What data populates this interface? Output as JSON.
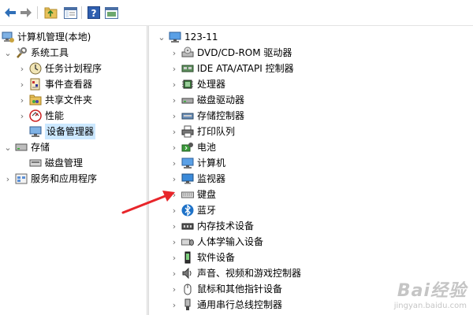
{
  "toolbar": {
    "icons": [
      "back-arrow-icon",
      "forward-arrow-icon",
      "up-folder-icon",
      "show-hide-tree-icon",
      "help-icon",
      "properties-icon"
    ]
  },
  "left_tree": {
    "root": "计算机管理(本地)",
    "system_tools": "系统工具",
    "task_scheduler": "任务计划程序",
    "event_viewer": "事件查看器",
    "shared_folders": "共享文件夹",
    "performance": "性能",
    "device_manager": "设备管理器",
    "storage": "存储",
    "disk_management": "磁盘管理",
    "services_apps": "服务和应用程序"
  },
  "right_tree": {
    "computer_name": "123-11",
    "categories": [
      {
        "label": "DVD/CD-ROM 驱动器",
        "icon": "dvd-drive-icon"
      },
      {
        "label": "IDE ATA/ATAPI 控制器",
        "icon": "ide-controller-icon"
      },
      {
        "label": "处理器",
        "icon": "processor-icon"
      },
      {
        "label": "磁盘驱动器",
        "icon": "disk-drive-icon"
      },
      {
        "label": "存储控制器",
        "icon": "storage-controller-icon"
      },
      {
        "label": "打印队列",
        "icon": "printer-icon"
      },
      {
        "label": "电池",
        "icon": "battery-icon"
      },
      {
        "label": "计算机",
        "icon": "computer-icon"
      },
      {
        "label": "监视器",
        "icon": "monitor-icon"
      },
      {
        "label": "键盘",
        "icon": "keyboard-icon"
      },
      {
        "label": "蓝牙",
        "icon": "bluetooth-icon"
      },
      {
        "label": "内存技术设备",
        "icon": "memory-device-icon"
      },
      {
        "label": "人体学输入设备",
        "icon": "hid-icon"
      },
      {
        "label": "软件设备",
        "icon": "software-device-icon"
      },
      {
        "label": "声音、视频和游戏控制器",
        "icon": "sound-icon"
      },
      {
        "label": "鼠标和其他指针设备",
        "icon": "mouse-icon"
      },
      {
        "label": "通用串行总线控制器",
        "icon": "usb-icon"
      }
    ]
  },
  "annotation": {
    "color": "#e8252a"
  },
  "watermark": {
    "main": "Bai经验",
    "sub": "jingyan.baidu.com"
  },
  "colors": {
    "selected": "#cce8ff",
    "accent": "#1e72c8"
  }
}
